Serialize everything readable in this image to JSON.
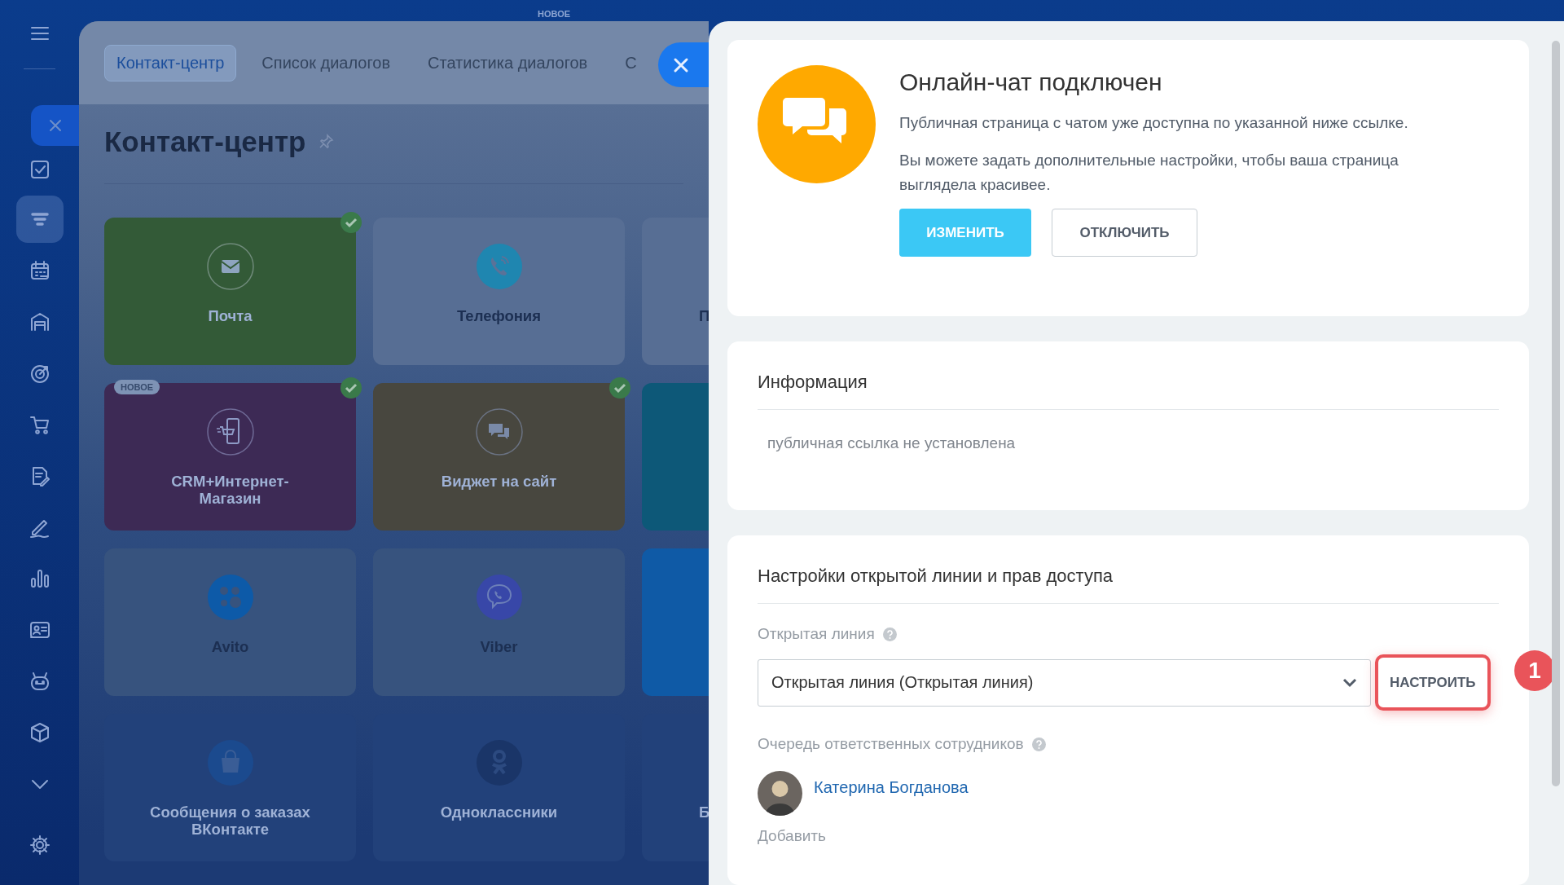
{
  "top_badge": "НОВОЕ",
  "sidebar": {
    "items": [
      {
        "kind": "menu",
        "selected": false
      },
      {
        "kind": "close",
        "selected": false
      },
      {
        "kind": "tasks",
        "selected": false
      },
      {
        "kind": "filter",
        "selected": true
      },
      {
        "kind": "calendar",
        "selected": false
      },
      {
        "kind": "store",
        "selected": false
      },
      {
        "kind": "target",
        "selected": false
      },
      {
        "kind": "cart",
        "selected": false
      },
      {
        "kind": "document",
        "selected": false
      },
      {
        "kind": "pen",
        "selected": false
      },
      {
        "kind": "chart",
        "selected": false
      },
      {
        "kind": "card",
        "selected": false
      },
      {
        "kind": "robot",
        "selected": false
      },
      {
        "kind": "box",
        "selected": false
      },
      {
        "kind": "more",
        "selected": false
      },
      {
        "kind": "settings",
        "selected": false
      }
    ]
  },
  "tabs": [
    {
      "label": "Контакт-центр",
      "selected": true
    },
    {
      "label": "Список диалогов",
      "selected": false
    },
    {
      "label": "Статистика диалогов",
      "selected": false
    },
    {
      "label": "С",
      "selected": false
    }
  ],
  "page_title": "Контакт-центр",
  "tiles": [
    {
      "kind": "full",
      "label": "Почта",
      "color": "#335a37",
      "checked": true
    },
    {
      "kind": "full",
      "label": "Телефония",
      "color": "#576e94",
      "checked": false
    },
    {
      "kind": "cut",
      "label": "П",
      "color": "#576e94"
    },
    {
      "kind": "full",
      "label": "CRM+Интернет-Магазин",
      "color": "#3d2a55",
      "checked": true,
      "badge": "НОВОЕ"
    },
    {
      "kind": "full",
      "label": "Виджет на сайт",
      "color": "#48473f",
      "checked": true
    },
    {
      "kind": "cut",
      "color": "#0d5878"
    },
    {
      "kind": "full",
      "label": "Avito",
      "color": "#37537e",
      "checked": false
    },
    {
      "kind": "full",
      "label": "Viber",
      "color": "#37537e",
      "checked": false
    },
    {
      "kind": "cut",
      "color": "#0f5aa6"
    },
    {
      "kind": "full",
      "label": "Сообщения о заказах ВКонтакте",
      "color": "#22417a",
      "checked": false
    },
    {
      "kind": "full",
      "label": "Одноклассники",
      "color": "#22417a",
      "checked": false
    },
    {
      "kind": "cut",
      "label": "Б",
      "color": "#22417a"
    }
  ],
  "slider": {
    "status": {
      "title": "Онлайн-чат подключен",
      "paragraphs": [
        "Публичная страница с чатом уже доступна по указанной ниже ссылке.",
        "Вы можете задать дополнительные настройки, чтобы ваша страница выглядела красивее."
      ],
      "buttons": [
        {
          "kind": "primary",
          "label": "ИЗМЕНИТЬ"
        },
        {
          "kind": "secondary",
          "label": "ОТКЛЮЧИТЬ"
        }
      ]
    },
    "info": {
      "title": "Информация",
      "text": "публичная ссылка не установлена"
    },
    "settings": {
      "title": "Настройки открытой линии и прав доступа",
      "open_line_label": "Открытая линия",
      "open_line_value": "Открытая линия (Открытая линия)",
      "configure_button": {
        "label": "НАСТРОИТЬ",
        "highlighted": true
      },
      "step_marker": "1",
      "queue_label": "Очередь ответственных сотрудников",
      "employees": [
        {
          "name": "Катерина Богданова"
        }
      ],
      "add_link": "Добавить"
    }
  }
}
